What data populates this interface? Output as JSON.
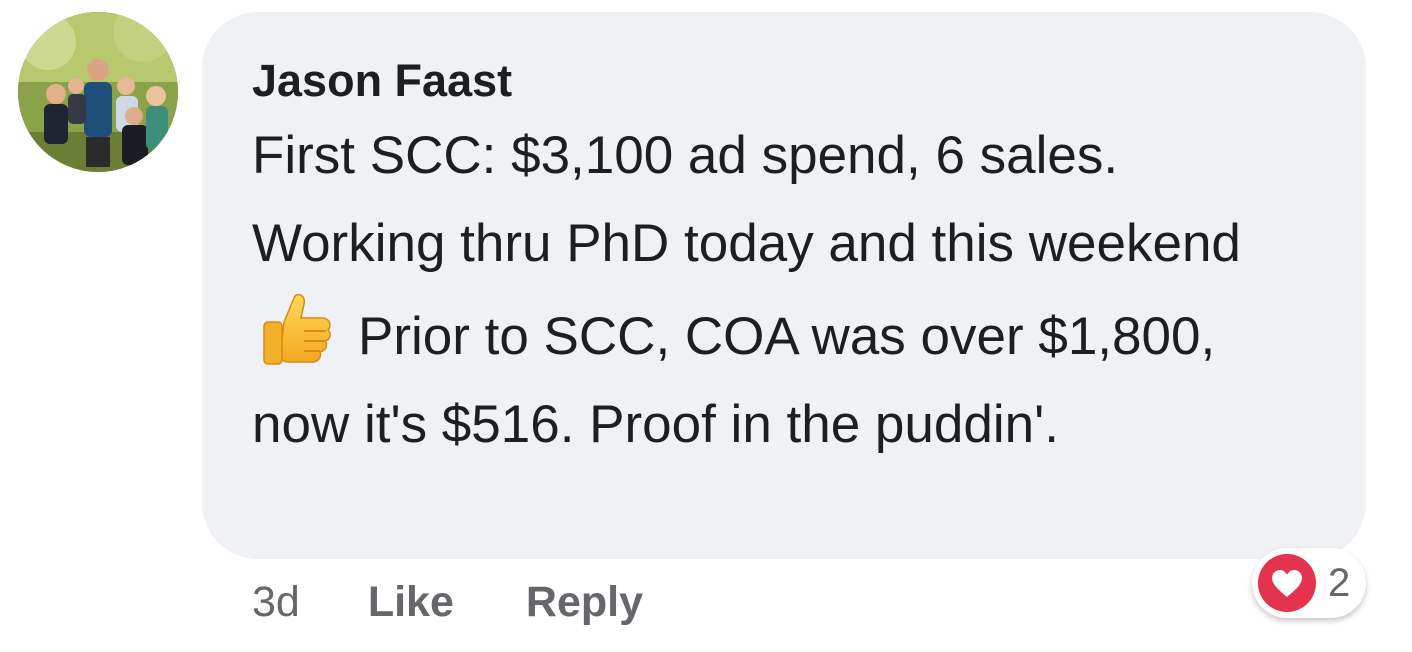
{
  "comment": {
    "author": "Jason Faast",
    "text_part1": "First SCC:  $3,100 ad spend, 6 sales. Working thru PhD today and this weekend",
    "emoji": "thumbs-up-icon",
    "text_part2": "Prior to SCC, COA was over $1,800, now it's $516.  Proof in the puddin'.",
    "timestamp": "3d",
    "like_label": "Like",
    "reply_label": "Reply",
    "reaction_type": "love",
    "reaction_count": "2"
  },
  "colors": {
    "bubble": "#eff1f4",
    "text": "#1c1e21",
    "meta": "#65676b",
    "heart": "#e4334d"
  }
}
